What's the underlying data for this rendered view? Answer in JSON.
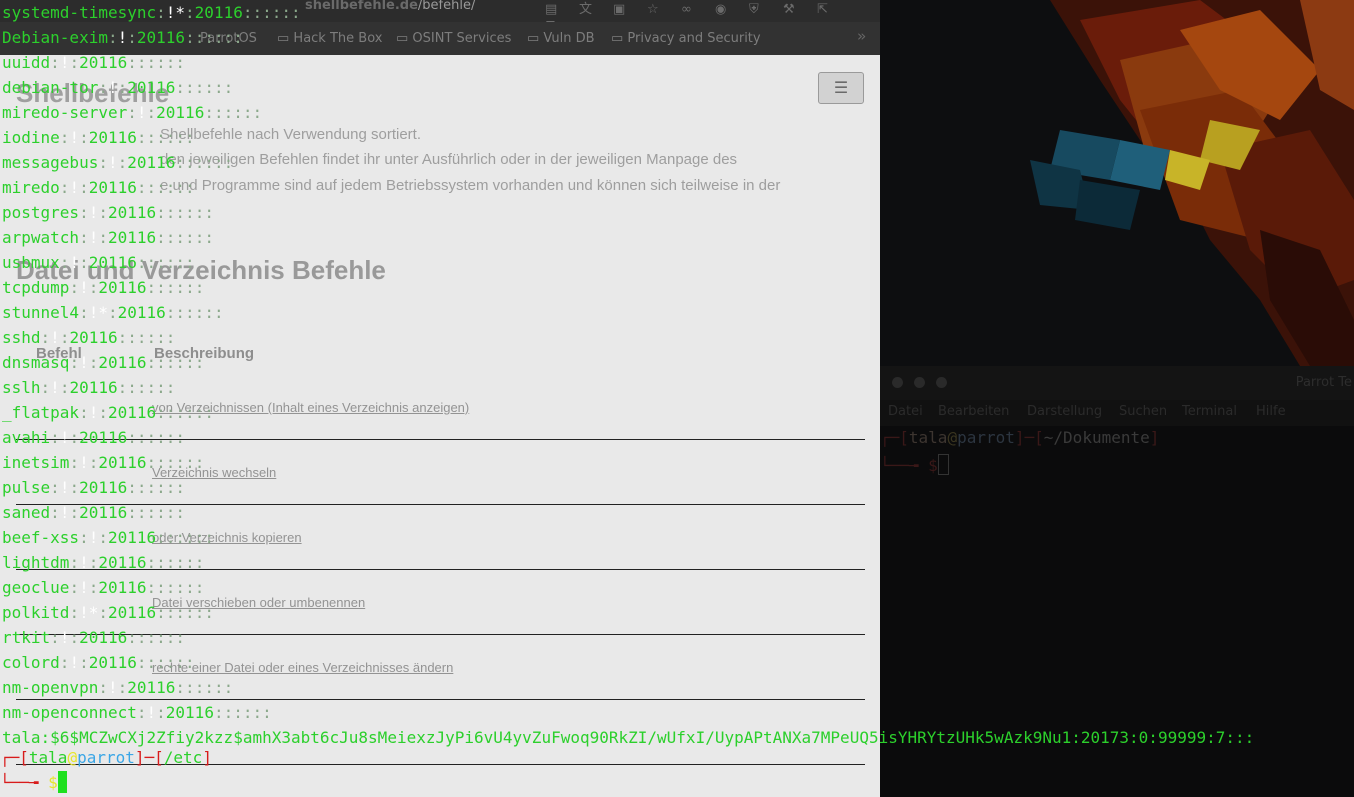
{
  "browser": {
    "url_domain": "shellbefehle.de",
    "url_path": "/befehle/",
    "bookmarks": [
      "ParrotOS",
      "Hack The Box",
      "OSINT Services",
      "Vuln DB",
      "Privacy and Security"
    ],
    "page_title": "Shellbefehle",
    "intro_lines": [
      "Shellbefehle nach Verwendung sortiert.",
      "den jeweiligen Befehlen findet ihr unter Ausführlich oder in der jeweiligen Manpage des",
      "e und Programme sind auf jedem Betriebssystem vorhanden und können sich teilweise in der"
    ],
    "section_title": "Datei und Verzeichnis Befehle",
    "table_header_col1": "Befehl",
    "table_header_col2": "Beschreibung",
    "rows": [
      "von Verzeichnissen (Inhalt eines Verzeichnis anzeigen)",
      "Verzeichnis wechseln",
      "oder Verzeichnis kopieren",
      "Datei verschieben oder umbenennen",
      "rechte einer Datei oder eines Verzeichnisses ändern"
    ]
  },
  "terminal": {
    "lines": [
      "systemd-timesync:!*:20116::::::",
      "Debian-exim:!:20116::::::",
      "uuidd:!:20116::::::",
      "debian-tor:!:20116::::::",
      "miredo-server:!:20116::::::",
      "iodine:!:20116::::::",
      "messagebus:!:20116::::::",
      "miredo:!:20116::::::",
      "postgres:!:20116::::::",
      "arpwatch:!:20116::::::",
      "usbmux:!:20116::::::",
      "tcpdump:!:20116::::::",
      "stunnel4:!*:20116::::::",
      "sshd:!:20116::::::",
      "dnsmasq:!:20116::::::",
      "sslh:!:20116::::::",
      "_flatpak:!:20116::::::",
      "avahi:!:20116::::::",
      "inetsim:!:20116::::::",
      "pulse:!:20116::::::",
      "saned:!:20116::::::",
      "beef-xss:!:20116::::::",
      "lightdm:!:20116::::::",
      "geoclue:!:20116::::::",
      "polkitd:!*:20116::::::",
      "rtkit:!:20116::::::",
      "colord:!:20116::::::",
      "nm-openvpn:!:20116::::::",
      "nm-openconnect:!:20116::::::",
      "tala:$6$MCZwCXj2Zfiy2kzz$amhX3abt6cJu8sMeiexzJyPi6vU4yvZuFwoq90RkZI/wUfxI/UypAPtANXa7MPeUQ5isYHRYtzUHk5wAzk9Nu1:20173:0:99999:7:::"
    ],
    "prompt_user": "tala",
    "prompt_at": "@",
    "prompt_host": "parrot",
    "prompt_path": "/etc",
    "prompt_dollar": "$"
  },
  "second_terminal": {
    "title": "Parrot Te",
    "menu": [
      "Datei",
      "Bearbeiten",
      "Darstellung",
      "Suchen",
      "Terminal",
      "Hilfe"
    ],
    "prompt_user": "tala",
    "prompt_at": "@",
    "prompt_host": "parrot",
    "prompt_path": "~/Dokumente",
    "prompt_dollar": "$"
  },
  "colors": {
    "terminal_green": "#2cd02c",
    "prompt_red": "#d81b1b",
    "prompt_yellow": "#e6e62c",
    "prompt_blue": "#3aa6e6"
  }
}
